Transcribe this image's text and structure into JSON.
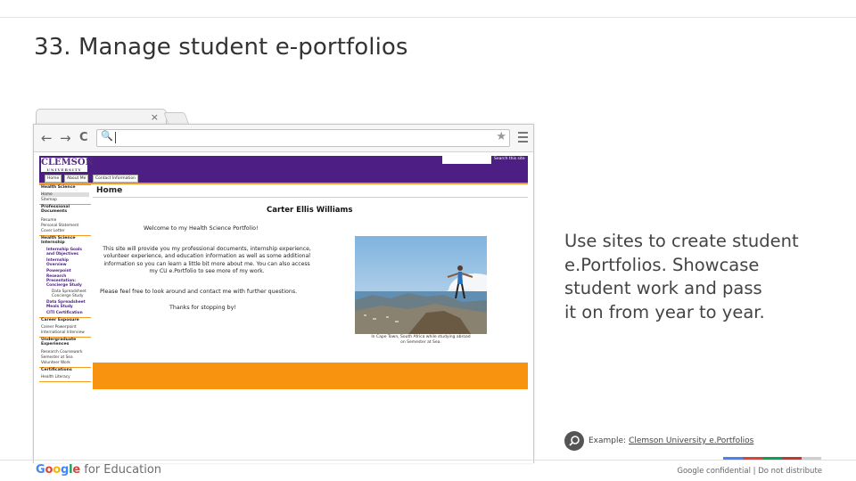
{
  "slide": {
    "title": "33. Manage student e-portfolios",
    "description_lines": [
      "Use sites to create student",
      "e.Portfolios. Showcase",
      "student work and pass",
      "it on from year to year."
    ],
    "example_label": "Example:",
    "example_link": "Clemson University e.Portfolios"
  },
  "footer": {
    "brand_google": "Google",
    "brand_for": " for Education",
    "confidential": "Google confidential | Do not distribute"
  },
  "browser": {
    "tab_close": "×",
    "back": "←",
    "forward": "→",
    "reload": "C"
  },
  "site": {
    "logo_main": "CLEMSON",
    "logo_sub": "UNIVERSITY",
    "search_label": "Search this site",
    "nav": [
      "Home",
      "About Me",
      "Contact Information"
    ],
    "sidebar": {
      "health_science": "Health Science",
      "home": "Home",
      "sitemap": "Sitemap",
      "professional_documents": "Professional Documents",
      "resume": "Resume",
      "personal_statement": "Personal Statement",
      "cover_letter": "Cover Letter",
      "internship": "Health Science Internship",
      "internship_goals": "Internship Goals and Objectives",
      "internship_overview": "Internship Overview",
      "powerpoint": "Powerpoint",
      "research": "Research Presentation: Concierge Study",
      "data_spreadsheet": "Data Spreadsheet Concierge Study",
      "data_spreadsheet2": "Data Spreadsheet Meals Study",
      "cit": "CITI Certification",
      "career": "Career Exposure",
      "career_powerpoint": "Career Powerpoint",
      "international": "International Interview",
      "undergraduate": "Undergraduate Experiences",
      "research_coursework": "Research Coursework",
      "semester": "Semester at Sea",
      "volunteer": "Volunteer Work",
      "certifications": "Certifications",
      "health_literacy": "Health Literacy"
    },
    "page_heading": "Home",
    "owner_name": "Carter Ellis Williams",
    "welcome": "Welcome to my Health Science Portfolio!",
    "intro": "This site will provide you my professional documents, internship experience, volunteer experience, and education information as well as some additional information so you can learn a little bit more about me. You can also access my CU e.Portfolio to see more of my work.",
    "contact": "Please feel free to look around and contact me with further questions.",
    "thanks": "Thanks for stopping by!",
    "photo_caption": "In Cape Town, South Africa while studying abroad on Semester at Sea."
  },
  "colors": {
    "clemson_purple": "#4d1f85",
    "clemson_orange": "#f7930e",
    "google_blue": "#4285f4",
    "google_red": "#db4437",
    "google_yellow": "#f4b400",
    "google_green": "#0f9d58"
  }
}
